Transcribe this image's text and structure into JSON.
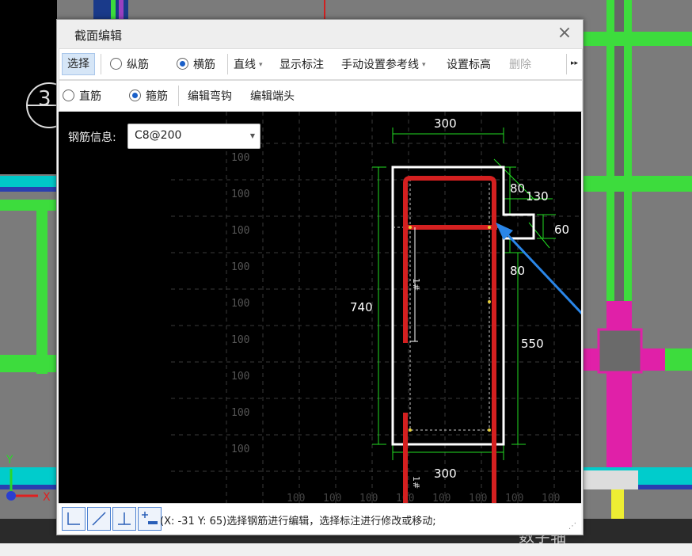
{
  "dialog": {
    "title": "截面编辑",
    "close_label": "×"
  },
  "toolbar1": {
    "select": "选择",
    "longitudinal": "纵筋",
    "transverse": "横筋",
    "line": "直线",
    "show_dim": "显示标注",
    "manual_ref": "手动设置参考线",
    "set_elev": "设置标高",
    "delete": "删除",
    "more": "▸▸",
    "transverse_checked": true
  },
  "toolbar2": {
    "straight": "直筋",
    "stirrup": "箍筋",
    "edit_hook": "编辑弯钩",
    "edit_end": "编辑端头",
    "stirrup_checked": true
  },
  "rebar_info": {
    "label": "钢筋信息:",
    "value": "C8@200"
  },
  "drawing": {
    "dims": {
      "top": "300",
      "bottom": "300",
      "left": "740",
      "right": "550",
      "notch_top": "80",
      "notch_w": "130",
      "notch_h": "60",
      "notch_bottom": "80"
    },
    "grid_labels": [
      "100",
      "100",
      "100",
      "100",
      "100",
      "100",
      "100",
      "100",
      "100"
    ],
    "bottom_labels": [
      "100",
      "100",
      "100",
      "100",
      "100",
      "100",
      "100",
      "100"
    ],
    "rebar_marks": [
      "1#",
      "1#"
    ],
    "colors": {
      "rebar": "#d42020",
      "outline": "#ffffff",
      "dim": "#22dd22",
      "arrow": "#2a86e8"
    }
  },
  "status": {
    "text": "(X: -31 Y: 65)选择钢筋进行编辑，选择标注进行修改或移动;"
  },
  "background": {
    "axis_text": "数字轴",
    "label_3": "3",
    "axis_y": "Y",
    "axis_x": "X"
  }
}
